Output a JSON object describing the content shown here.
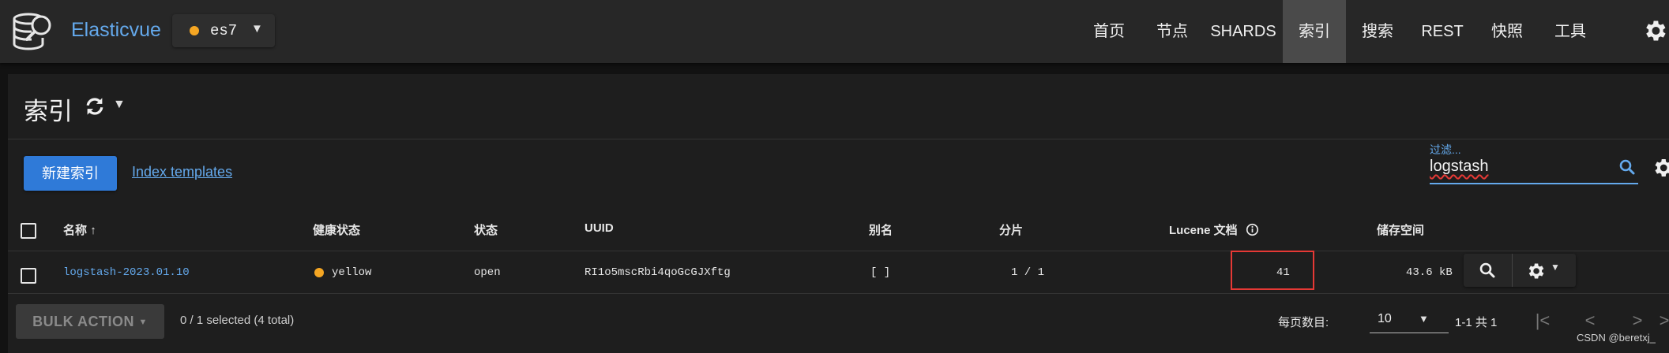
{
  "app": {
    "brand": "Elasticvue",
    "cluster": "es7",
    "cluster_status_color": "#f5a623",
    "accent": "#64a9ec"
  },
  "nav": [
    {
      "label": "首页"
    },
    {
      "label": "节点"
    },
    {
      "label": "SHARDS"
    },
    {
      "label": "索引",
      "active": true
    },
    {
      "label": "搜索"
    },
    {
      "label": "REST"
    },
    {
      "label": "快照"
    },
    {
      "label": "工具"
    }
  ],
  "page": {
    "title": "索引"
  },
  "toolbar": {
    "new_index": "新建索引",
    "templates_link": "Index templates"
  },
  "filter": {
    "label": "过滤...",
    "value": "logstash"
  },
  "table": {
    "headers": {
      "name": "名称",
      "health": "健康状态",
      "status": "状态",
      "uuid": "UUID",
      "aliases": "别名",
      "shards": "分片",
      "docs": "Lucene 文档",
      "storage": "储存空间"
    },
    "sort_indicator": "↑",
    "rows": [
      {
        "name": "logstash-2023.01.10",
        "health": "yellow",
        "health_color": "#f5a623",
        "status": "open",
        "uuid": "RI1o5mscRbi4qoGcGJXftg",
        "aliases": "[ ]",
        "shards": "1 / 1",
        "docs": "41",
        "storage": "43.6 kB"
      }
    ]
  },
  "footer": {
    "bulk_action": "BULK ACTION",
    "selected": "0 / 1 selected (4 total)",
    "per_page_label": "每页数目:",
    "per_page_value": "10",
    "range": "1-1 共 1"
  },
  "watermark": "CSDN @beretxj_",
  "icons": [
    "logo-icon",
    "gear-icon",
    "refresh-icon",
    "search-icon",
    "chevron-down-icon",
    "info-icon",
    "first-page-icon",
    "prev-page-icon",
    "next-page-icon",
    "last-page-icon"
  ]
}
